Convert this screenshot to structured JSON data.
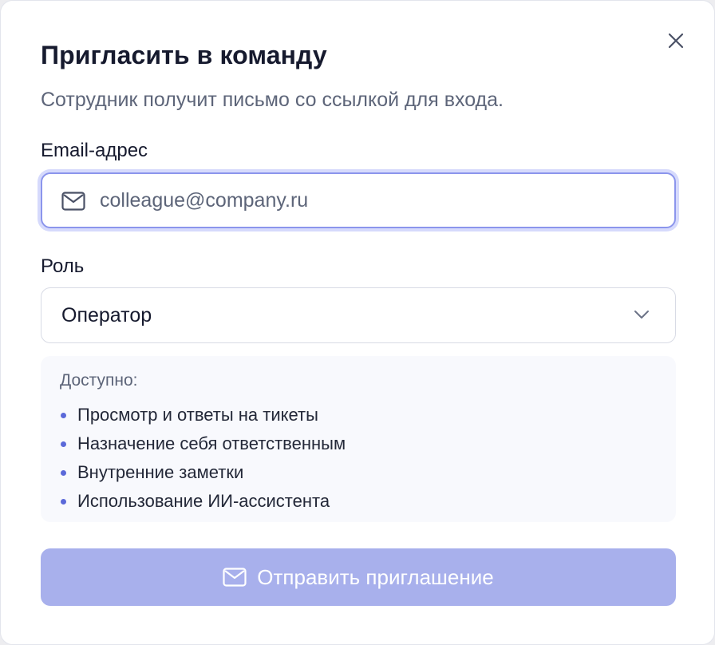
{
  "dialog": {
    "title": "Пригласить в команду",
    "subtitle": "Сотрудник получит письмо со ссылкой для входа.",
    "close_icon": "close-icon"
  },
  "email": {
    "label": "Email-адрес",
    "placeholder": "colleague@company.ru",
    "value": "",
    "icon": "mail-icon"
  },
  "role": {
    "label": "Роль",
    "selected": "Оператор",
    "icon": "chevron-down-icon"
  },
  "permissions": {
    "title": "Доступно:",
    "items": [
      "Просмотр и ответы на тикеты",
      "Назначение себя ответственным",
      "Внутренние заметки",
      "Использование ИИ-ассистента"
    ]
  },
  "submit": {
    "label": "Отправить приглашение",
    "icon": "mail-icon",
    "disabled": true
  },
  "colors": {
    "accent": "#5b69d9",
    "focus_border": "#8b95ec",
    "button_disabled": "#a8b0ec",
    "text_primary": "#161a2e",
    "text_secondary": "#5d6579"
  }
}
